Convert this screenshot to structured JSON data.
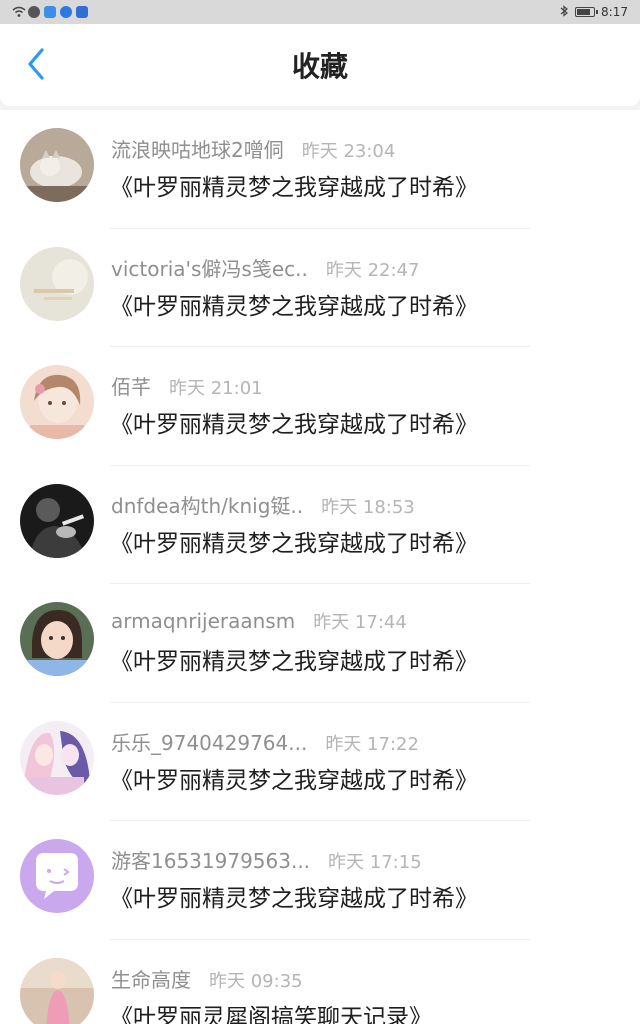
{
  "status_bar": {
    "time": "8:17",
    "battery_level": 0.85,
    "icons": [
      "wifi-icon",
      "wechat-icon",
      "app-q-icon",
      "app-browser-icon",
      "app-shield-icon",
      "bluetooth-icon",
      "battery-icon"
    ]
  },
  "header": {
    "title": "收藏",
    "back_icon": "chevron-left-icon",
    "accent_color": "#2b9af3"
  },
  "items": [
    {
      "name": "流浪映咕地球2噌侗",
      "time": "昨天 23:04",
      "content": "《叶罗丽精灵梦之我穿越成了时希》"
    },
    {
      "name": "victoria's僻冯s笺ec..",
      "time": "昨天 22:47",
      "content": "《叶罗丽精灵梦之我穿越成了时希》"
    },
    {
      "name": "佰芊",
      "time": "昨天 21:01",
      "content": "《叶罗丽精灵梦之我穿越成了时希》"
    },
    {
      "name": "dnfdea构th/knig铤..",
      "time": "昨天 18:53",
      "content": "《叶罗丽精灵梦之我穿越成了时希》"
    },
    {
      "name": "armaqnrijeraansm",
      "time": "昨天 17:44",
      "content": "《叶罗丽精灵梦之我穿越成了时希》"
    },
    {
      "name": "乐乐_9740429764...",
      "time": "昨天 17:22",
      "content": "《叶罗丽精灵梦之我穿越成了时希》"
    },
    {
      "name": "游客16531979563...",
      "time": "昨天 17:15",
      "content": "《叶罗丽精灵梦之我穿越成了时希》"
    },
    {
      "name": "生命高度",
      "time": "昨天 09:35",
      "content": "《叶罗丽灵犀阁搞笑聊天记录》"
    }
  ]
}
